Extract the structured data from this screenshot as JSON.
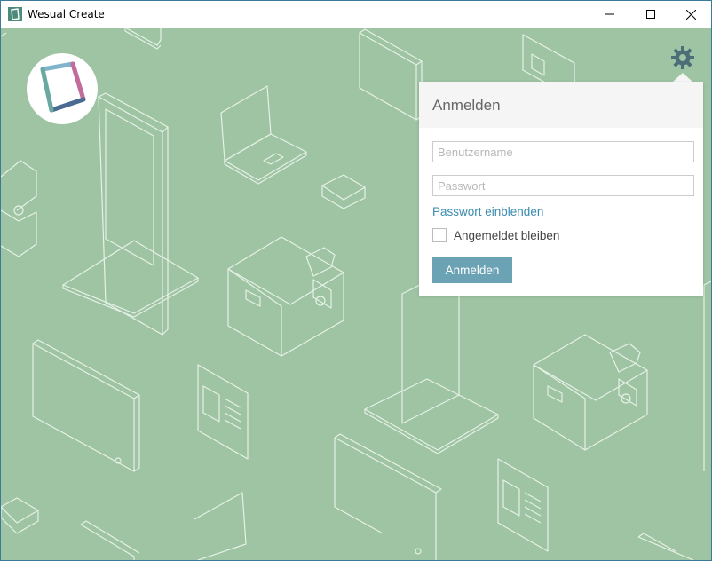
{
  "window": {
    "title": "Wesual Create"
  },
  "colors": {
    "background": "#9ec4a4",
    "accent": "#6ba3b4",
    "link": "#3a8cb0",
    "gear": "#4d6e78"
  },
  "settings": {
    "icon": "gear-icon"
  },
  "login": {
    "title": "Anmelden",
    "username_placeholder": "Benutzername",
    "password_placeholder": "Passwort",
    "show_password": "Passwort einblenden",
    "remember_label": "Angemeldet bleiben",
    "submit_label": "Anmelden"
  }
}
